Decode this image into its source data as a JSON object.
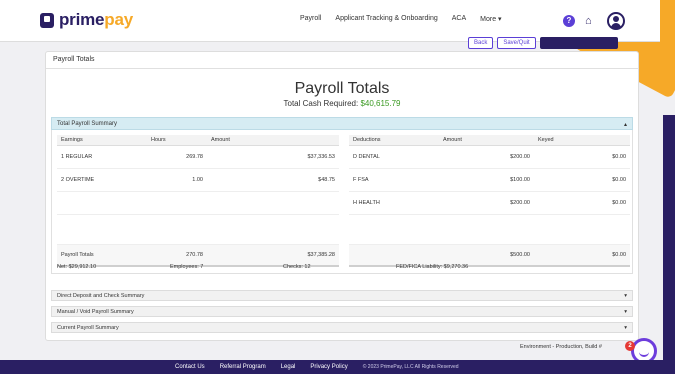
{
  "brand": {
    "name_part1": "prime",
    "name_part2": "pay"
  },
  "nav": {
    "links": [
      "Payroll",
      "Applicant Tracking & Onboarding",
      "ACA",
      "More ▾"
    ]
  },
  "icons": {
    "help": "?",
    "home": "⌂"
  },
  "actions": [
    "Back",
    "Save/Quit",
    ""
  ],
  "card": {
    "header": "Payroll Totals",
    "title": "Payroll Totals",
    "cash_label": "Total Cash Required:",
    "cash_amount": "$40,615.79"
  },
  "summary": {
    "label": "Total Payroll Summary",
    "toggle": "▴",
    "earnings": {
      "headers": [
        "Earnings",
        "Hours",
        "Amount"
      ],
      "rows": [
        [
          "1 REGULAR",
          "269.78",
          "$37,336.53"
        ],
        [
          "2 OVERTIME",
          "1.00",
          "$48.75"
        ]
      ],
      "total": [
        "Payroll Totals",
        "270.78",
        "$37,385.28"
      ]
    },
    "deductions": {
      "headers": [
        "Deductions",
        "Amount",
        "Keyed"
      ],
      "rows": [
        [
          "D DENTAL",
          "$200.00",
          "$0.00"
        ],
        [
          "F FSA",
          "$100.00",
          "$0.00"
        ],
        [
          "H HEALTH",
          "$200.00",
          "$0.00"
        ]
      ],
      "total": [
        "",
        "$500.00",
        "$0.00"
      ]
    },
    "stats": {
      "net": "Net: $29,912.10",
      "employees": "Employees: 7",
      "checks": "Checks: 12",
      "fed": "FED/FICA Liability: $9,270.36"
    }
  },
  "sections": [
    {
      "label": "Direct Deposit and Check Summary",
      "toggle": "▾"
    },
    {
      "label": "Manual / Void Payroll Summary",
      "toggle": "▾"
    },
    {
      "label": "Current Payroll Summary",
      "toggle": "▾"
    }
  ],
  "environment": "Environment - Production,  Build #",
  "chat_badge": "2",
  "footer": {
    "links": [
      "Contact Us",
      "Referral Program",
      "Legal",
      "Privacy Policy"
    ],
    "copyright": "© 2023 PrimePay, LLC All Rights Reserved"
  },
  "colors": {
    "brand": "#2a1f63",
    "accent": "#f6a928",
    "positive": "#3a9a22"
  }
}
